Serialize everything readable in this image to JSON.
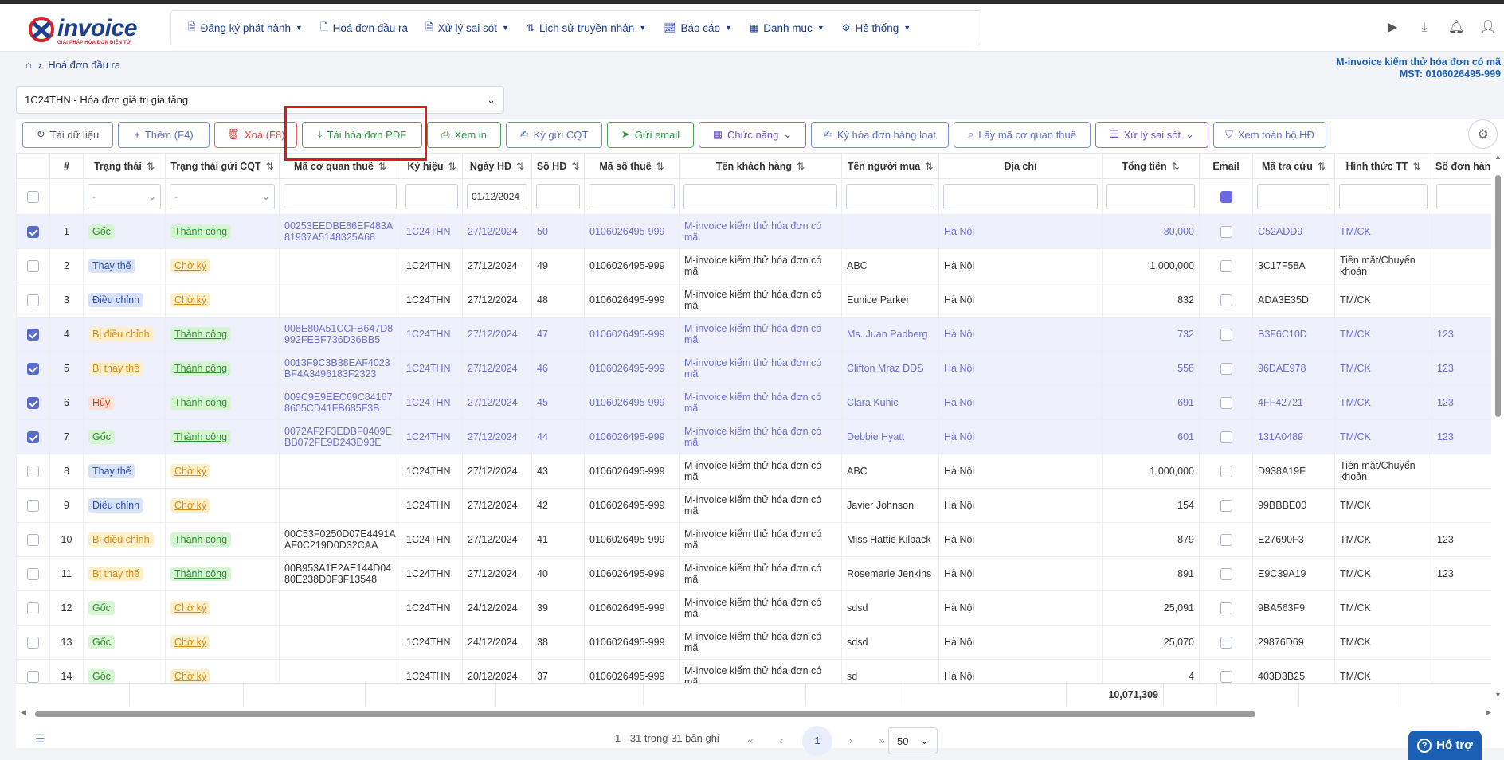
{
  "brand": {
    "name": "invoice",
    "tagline": "GIẢI PHÁP HÓA ĐƠN ĐIỆN TỬ",
    "colors": {
      "primary": "#1a3c8e",
      "accent": "#d9222a"
    }
  },
  "nav": {
    "items": [
      {
        "label": "Đăng ký phát hành",
        "icon": "register-icon",
        "dropdown": true
      },
      {
        "label": "Hoá đơn đầu ra",
        "icon": "invoice-icon",
        "dropdown": false
      },
      {
        "label": "Xử lý sai sót",
        "icon": "fix-icon",
        "dropdown": true
      },
      {
        "label": "Lịch sử truyền nhận",
        "icon": "history-icon",
        "dropdown": true
      },
      {
        "label": "Báo cáo",
        "icon": "chart-icon",
        "dropdown": true
      },
      {
        "label": "Danh mục",
        "icon": "grid-icon",
        "dropdown": true
      },
      {
        "label": "Hệ thống",
        "icon": "gear-icon",
        "dropdown": true
      }
    ]
  },
  "breadcrumb": {
    "current": "Hoá đơn đầu ra"
  },
  "company": {
    "name": "M-invoice kiểm thử hóa đơn có mã",
    "tax": "MST: 0106026495-999"
  },
  "template_select": {
    "value": "1C24THN - Hóa đơn giá trị gia tăng"
  },
  "toolbar": {
    "reload": "Tải dữ liệu",
    "add": "Thêm (F4)",
    "delete": "Xoá (F8)",
    "download_pdf": "Tải hóa đơn PDF",
    "print": "Xem in",
    "sign_send": "Ký gửi CQT",
    "email": "Gửi email",
    "functions": "Chức năng",
    "sign_batch": "Ký hóa đơn hàng loạt",
    "get_code": "Lấy mã cơ quan thuế",
    "error_handle": "Xử lý sai sót",
    "view_all": "Xem toàn bộ HĐ"
  },
  "table": {
    "headers": {
      "idx": "#",
      "status": "Trạng thái",
      "send_status": "Trạng thái gửi CQT",
      "tax_code_auth": "Mã cơ quan thuế",
      "symbol": "Ký hiệu",
      "date": "Ngày HĐ",
      "number": "Số HĐ",
      "tax_id": "Mã số thuế",
      "customer": "Tên khách hàng",
      "buyer": "Tên người mua",
      "address": "Địa chỉ",
      "total": "Tổng tiền",
      "email": "Email",
      "lookup": "Mã tra cứu",
      "payment": "Hình thức TT",
      "order_no": "Số đơn hàn"
    },
    "filters": {
      "status": "-",
      "send_status": "-",
      "date": "01/12/2024"
    },
    "rows": [
      {
        "sel": true,
        "idx": "1",
        "status": "Gốc",
        "st": "green",
        "send": "Thành công",
        "sd": "green",
        "code": "00253EEDBE86EF483A81937A5148325A68",
        "sym": "1C24THN",
        "date": "27/12/2024",
        "num": "50",
        "tax": "0106026495-999",
        "cust": "M-invoice kiểm thử hóa đơn có mã",
        "buyer": "",
        "addr": "Hà Nội",
        "total": "80,000",
        "lookup": "C52ADD9",
        "pay": "TM/CK",
        "order": ""
      },
      {
        "sel": false,
        "idx": "2",
        "status": "Thay thế",
        "st": "blue",
        "send": "Chờ ký",
        "sd": "orange",
        "code": "",
        "sym": "1C24THN",
        "date": "27/12/2024",
        "num": "49",
        "tax": "0106026495-999",
        "cust": "M-invoice kiểm thử hóa đơn có mã",
        "buyer": "ABC",
        "addr": "Hà Nội",
        "total": "1,000,000",
        "lookup": "3C17F58A",
        "pay": "Tiền mặt/Chuyển khoản",
        "order": ""
      },
      {
        "sel": false,
        "idx": "3",
        "status": "Điều chỉnh",
        "st": "blue",
        "send": "Chờ ký",
        "sd": "orange",
        "code": "",
        "sym": "1C24THN",
        "date": "27/12/2024",
        "num": "48",
        "tax": "0106026495-999",
        "cust": "M-invoice kiểm thử hóa đơn có mã",
        "buyer": "Eunice Parker",
        "addr": "Hà Nội",
        "total": "832",
        "lookup": "ADA3E35D",
        "pay": "TM/CK",
        "order": ""
      },
      {
        "sel": true,
        "idx": "4",
        "status": "Bị điều chỉnh",
        "st": "orange",
        "send": "Thành công",
        "sd": "green",
        "code": "008E80A51CCFB647D8992FEBF736D36BB5",
        "sym": "1C24THN",
        "date": "27/12/2024",
        "num": "47",
        "tax": "0106026495-999",
        "cust": "M-invoice kiểm thử hóa đơn có mã",
        "buyer": "Ms. Juan Padberg",
        "addr": "Hà Nội",
        "total": "732",
        "lookup": "B3F6C10D",
        "pay": "TM/CK",
        "order": "123"
      },
      {
        "sel": true,
        "idx": "5",
        "status": "Bị thay thế",
        "st": "orange",
        "send": "Thành công",
        "sd": "green",
        "code": "0013F9C3B38EAF4023BF4A3496183F2323",
        "sym": "1C24THN",
        "date": "27/12/2024",
        "num": "46",
        "tax": "0106026495-999",
        "cust": "M-invoice kiểm thử hóa đơn có mã",
        "buyer": "Clifton Mraz DDS",
        "addr": "Hà Nội",
        "total": "558",
        "lookup": "96DAE978",
        "pay": "TM/CK",
        "order": "123"
      },
      {
        "sel": true,
        "idx": "6",
        "status": "Hủy",
        "st": "red",
        "send": "Thành công",
        "sd": "green",
        "code": "009C9E9EEC69C841678605CD41FB685F3B",
        "sym": "1C24THN",
        "date": "27/12/2024",
        "num": "45",
        "tax": "0106026495-999",
        "cust": "M-invoice kiểm thử hóa đơn có mã",
        "buyer": "Clara Kuhic",
        "addr": "Hà Nội",
        "total": "691",
        "lookup": "4FF42721",
        "pay": "TM/CK",
        "order": "123"
      },
      {
        "sel": true,
        "idx": "7",
        "status": "Gốc",
        "st": "green",
        "send": "Thành công",
        "sd": "green",
        "code": "0072AF2F3EDBF0409EBB072FE9D243D93E",
        "sym": "1C24THN",
        "date": "27/12/2024",
        "num": "44",
        "tax": "0106026495-999",
        "cust": "M-invoice kiểm thử hóa đơn có mã",
        "buyer": "Debbie Hyatt",
        "addr": "Hà Nội",
        "total": "601",
        "lookup": "131A0489",
        "pay": "TM/CK",
        "order": "123"
      },
      {
        "sel": false,
        "idx": "8",
        "status": "Thay thế",
        "st": "blue",
        "send": "Chờ ký",
        "sd": "orange",
        "code": "",
        "sym": "1C24THN",
        "date": "27/12/2024",
        "num": "43",
        "tax": "0106026495-999",
        "cust": "M-invoice kiểm thử hóa đơn có mã",
        "buyer": "ABC",
        "addr": "Hà Nội",
        "total": "1,000,000",
        "lookup": "D938A19F",
        "pay": "Tiền mặt/Chuyển khoản",
        "order": ""
      },
      {
        "sel": false,
        "idx": "9",
        "status": "Điều chỉnh",
        "st": "blue",
        "send": "Chờ ký",
        "sd": "orange",
        "code": "",
        "sym": "1C24THN",
        "date": "27/12/2024",
        "num": "42",
        "tax": "0106026495-999",
        "cust": "M-invoice kiểm thử hóa đơn có mã",
        "buyer": "Javier Johnson",
        "addr": "Hà Nội",
        "total": "154",
        "lookup": "99BBBE00",
        "pay": "TM/CK",
        "order": ""
      },
      {
        "sel": false,
        "idx": "10",
        "status": "Bị điều chỉnh",
        "st": "orange",
        "send": "Thành công",
        "sd": "green",
        "code": "00C53F0250D07E4491AAF0C219D0D32CAA",
        "sym": "1C24THN",
        "date": "27/12/2024",
        "num": "41",
        "tax": "0106026495-999",
        "cust": "M-invoice kiểm thử hóa đơn có mã",
        "buyer": "Miss Hattie Kilback",
        "addr": "Hà Nội",
        "total": "879",
        "lookup": "E27690F3",
        "pay": "TM/CK",
        "order": "123"
      },
      {
        "sel": false,
        "idx": "11",
        "status": "Bị thay thế",
        "st": "orange",
        "send": "Thành công",
        "sd": "green",
        "code": "00B953A1E2AE144D0480E238D0F3F13548",
        "sym": "1C24THN",
        "date": "27/12/2024",
        "num": "40",
        "tax": "0106026495-999",
        "cust": "M-invoice kiểm thử hóa đơn có mã",
        "buyer": "Rosemarie Jenkins",
        "addr": "Hà Nội",
        "total": "891",
        "lookup": "E9C39A19",
        "pay": "TM/CK",
        "order": "123"
      },
      {
        "sel": false,
        "idx": "12",
        "status": "Gốc",
        "st": "green",
        "send": "Chờ ký",
        "sd": "orange",
        "code": "",
        "sym": "1C24THN",
        "date": "24/12/2024",
        "num": "39",
        "tax": "0106026495-999",
        "cust": "M-invoice kiểm thử hóa đơn có mã",
        "buyer": "sdsd",
        "addr": "Hà Nội",
        "total": "25,091",
        "lookup": "9BA563F9",
        "pay": "TM/CK",
        "order": ""
      },
      {
        "sel": false,
        "idx": "13",
        "status": "Gốc",
        "st": "green",
        "send": "Chờ ký",
        "sd": "orange",
        "code": "",
        "sym": "1C24THN",
        "date": "24/12/2024",
        "num": "38",
        "tax": "0106026495-999",
        "cust": "M-invoice kiểm thử hóa đơn có mã",
        "buyer": "sdsd",
        "addr": "Hà Nội",
        "total": "25,070",
        "lookup": "29876D69",
        "pay": "TM/CK",
        "order": ""
      },
      {
        "sel": false,
        "idx": "14",
        "status": "Gốc",
        "st": "green",
        "send": "Chờ ký",
        "sd": "orange",
        "code": "",
        "sym": "1C24THN",
        "date": "20/12/2024",
        "num": "37",
        "tax": "0106026495-999",
        "cust": "M-invoice kiểm thử hóa đơn có mã",
        "buyer": "sd",
        "addr": "Hà Nội",
        "total": "4",
        "lookup": "403D3B25",
        "pay": "TM/CK",
        "order": ""
      }
    ],
    "sum_total": "10,071,309"
  },
  "pager": {
    "info": "1 - 31 trong 31 bản ghi",
    "current": "1",
    "page_size": "50"
  },
  "help": {
    "label": "Hỗ trợ"
  }
}
